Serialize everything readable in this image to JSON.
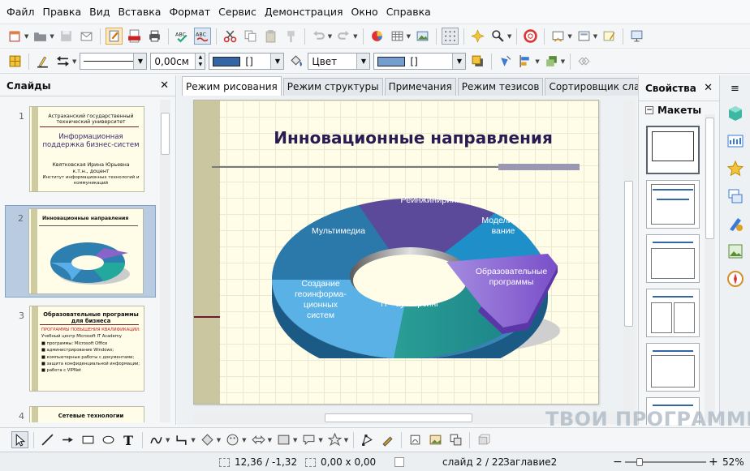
{
  "menu": [
    "Файл",
    "Правка",
    "Вид",
    "Вставка",
    "Формат",
    "Сервис",
    "Демонстрация",
    "Окно",
    "Справка"
  ],
  "toolbar2": {
    "line_width": "0,00см",
    "line_color_value": "[]",
    "area_style": "Цвет",
    "area_color_value": "[]"
  },
  "slides_panel": {
    "title": "Слайды",
    "close": "✕",
    "items": [
      {
        "num": "1",
        "title": "Астраханский государственный технический университет",
        "subtitle": "Информационная поддержка бизнес-систем",
        "author": "Квятковская Ирина Юрьевна",
        "degree": "к.т.н., доцент",
        "institute": "Институт информационных технологий и коммуникаций"
      },
      {
        "num": "2",
        "title": "Инновационные направления"
      },
      {
        "num": "3",
        "title": "Образовательные программы для бизнеса",
        "lines": [
          "ПРОГРАММЫ ПОВЫШЕНИЯ КВАЛИФИКАЦИИ:",
          "Учебный центр Microsoft IT Academy",
          "■ программы: Microsoft Office",
          "■ администрирование Windows;",
          "■ компьютерные работы с документами;",
          "■ защита конфиденциальной информации;",
          "■ работа с VIPNet"
        ]
      },
      {
        "num": "4",
        "title": "Сетевые технологии"
      }
    ]
  },
  "tabs": [
    "Режим рисования",
    "Режим структуры",
    "Примечания",
    "Режим тезисов",
    "Сортировщик слайдов"
  ],
  "slide": {
    "title": "Инновационные направления",
    "segments": [
      "Реинжиниринг",
      "Моделиро-вание",
      "Образовательные программы",
      "IT - аутсорсинг",
      "Создание геоинформа-ционных систем",
      "Мультимедиа"
    ]
  },
  "properties_panel": {
    "title": "Свойства",
    "close": "✕",
    "section": "Макеты"
  },
  "status": {
    "position": "12,36 / -1,32",
    "size": "0,00 x 0,00",
    "slide": "слайд 2 / 22",
    "layout": "Заглавие2",
    "zoom": "52%"
  },
  "watermark": "ТВОИ ПРОГРАММЫ РУ",
  "colors": {
    "accent": "#2a1a52",
    "line": "#3465a4",
    "fill": "#729fcf",
    "slide_bg": "#fffde8"
  }
}
